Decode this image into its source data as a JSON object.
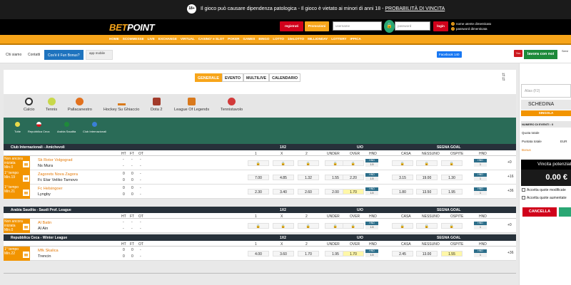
{
  "banner": {
    "age": "18+",
    "text": "Il gioco può causare dipendenza patologica - Il gioco è vietato ai minori di anni 18 - ",
    "link": "PROBABILITÀ DI VINCITA"
  },
  "header": {
    "logo_prefix": "BET",
    "logo_rest": "POINT",
    "register": "registrati",
    "promo": "Promozioni",
    "username_placeholder": "username",
    "password_placeholder": "password",
    "login": "login",
    "forgot_user": "nome utente dimenticato",
    "forgot_pass": "password dimenticata"
  },
  "nav": [
    "HOME",
    "SCOMMESSE",
    "LIVE",
    "EXCHANGE",
    "VIRTUAL",
    "CASINO' e SLOT",
    "POKER",
    "GAMES",
    "BINGO",
    "LOTTO",
    "10eLOTTO",
    "MILLIONDAY",
    "LOTTERY",
    "IPPICA"
  ],
  "subnav": {
    "chi_siamo": "Chi siamo",
    "contatti": "Contatti",
    "bonus": "Cos'è il Fun Bonus?",
    "app": "app mobile",
    "fb": "Facebook",
    "fb_count": "140",
    "youtube": "You Tube",
    "lavora": "lavora con noi",
    "servizi": "Servi"
  },
  "tabs": [
    "GENERALE",
    "EVENTO",
    "MULTILIVE",
    "CALENDARIO"
  ],
  "sports": [
    "Calcio",
    "Tennis",
    "Pallacanestro",
    "Hockey Su Ghiaccio",
    "Dota 2",
    "League Of Legends",
    "Tennistavolo"
  ],
  "filters": [
    "Tutte",
    "Repubblica Ceca",
    "Arabia Saudita",
    "Club Internazionali"
  ],
  "columns": {
    "c1x2": "1X2",
    "uo": "U/O",
    "sg": "SEGNA GOAL",
    "ht": "HT",
    "ft": "FT",
    "ot": "OT",
    "one": "1",
    "x": "X",
    "two": "2",
    "under": "UNDER",
    "over": "OVER",
    "hnd": "HND",
    "casa": "CASA",
    "nessuno": "NESSUNO",
    "ospite": "OSPITE"
  },
  "groups": [
    {
      "name": "Club Internazionali - Amichevoli",
      "matches": [
        {
          "status": "Non ancora iniziata",
          "time": "Min.0",
          "home": "Sk Rotor Volgograd",
          "away": "Ns Mura",
          "ht": [
            "-",
            "-"
          ],
          "ft": [
            "-",
            "-"
          ],
          "ot": [
            "-",
            "-"
          ],
          "odds": [
            "🔒",
            "🔒",
            "🔒",
            "🔒",
            "🔒"
          ],
          "hnd": "1.5",
          "sg": [
            "🔒",
            "🔒",
            "🔒"
          ],
          "hnd2": "1",
          "more": "+0"
        },
        {
          "status": "1° tempo",
          "time": "Min.19",
          "home": "Zagorets Nova Zagora",
          "away": "Fc Etar Veliko Tarnovo",
          "ht": [
            "0",
            "0"
          ],
          "ft": [
            "0",
            "0"
          ],
          "ot": [
            "-",
            "-"
          ],
          "odds": [
            "7.00",
            "4.85",
            "1.32",
            "1.55",
            "2.20"
          ],
          "hnd": "1.5",
          "sg": [
            "3.15",
            "19.00",
            "1.30"
          ],
          "hnd2": "1",
          "more": "+16"
        },
        {
          "status": "1° tempo",
          "time": "Min.21",
          "home": "Fc Helsingoer",
          "away": "Lyngby",
          "ht": [
            "0",
            "0"
          ],
          "ft": [
            "0",
            "0"
          ],
          "ot": [
            "-",
            "-"
          ],
          "odds": [
            "2.30",
            "3.40",
            "2.60",
            "2.00",
            "1.70"
          ],
          "hnd": "1.5",
          "sg": [
            "1.80",
            "13.50",
            "1.95"
          ],
          "hnd2": "1",
          "more": "+36"
        }
      ]
    },
    {
      "name": "Arabia Saudita - Saudi Prof. League",
      "matches": [
        {
          "status": "Non ancora iniziata",
          "time": "Min.0",
          "home": "Al Batin",
          "away": "Al Ain",
          "ht": [
            "-",
            "-"
          ],
          "ft": [
            "-",
            "-"
          ],
          "ot": [
            "-",
            "-"
          ],
          "odds": [
            "🔒",
            "🔒",
            "🔒",
            "🔒",
            "🔒"
          ],
          "hnd": "1.5",
          "sg": [
            "🔒",
            "🔒",
            "🔒"
          ],
          "hnd2": "1",
          "more": "+0"
        }
      ]
    },
    {
      "name": "Repubblica Ceca - Winter League",
      "matches": [
        {
          "status": "1° tempo",
          "time": "Min.22",
          "home": "Mfk Skalica",
          "away": "Trencin",
          "ht": [
            "0",
            "0"
          ],
          "ft": [
            "0",
            "0"
          ],
          "ot": [
            "-",
            "-"
          ],
          "odds": [
            "4.00",
            "3.60",
            "1.70",
            "1.95",
            "1.70"
          ],
          "hnd": "1.5",
          "sg": [
            "2.45",
            "13.00",
            "1.55"
          ],
          "hnd2": "1",
          "more": "+36"
        }
      ]
    }
  ],
  "sidebar": {
    "alias": "Alias (F2)",
    "schedina": "SCHEDINA",
    "singola": "SINGOLA",
    "num_eventi": "NUMERO DI EVENTI : 0",
    "quota": "Quota totale",
    "puntata": "Puntata totale",
    "currency": "EUR",
    "bonus": "Bonus",
    "vincita_label": "Vincita potenziale",
    "vincita": "0.00 €",
    "accetta1": "Accetta quote modificate",
    "accetta2": "Accetta quote aumentate",
    "cancella": "CANCELLA"
  },
  "colors": {
    "orange": "#f7a51a",
    "dark": "#1b1b1b",
    "green": "#2a6b57"
  }
}
